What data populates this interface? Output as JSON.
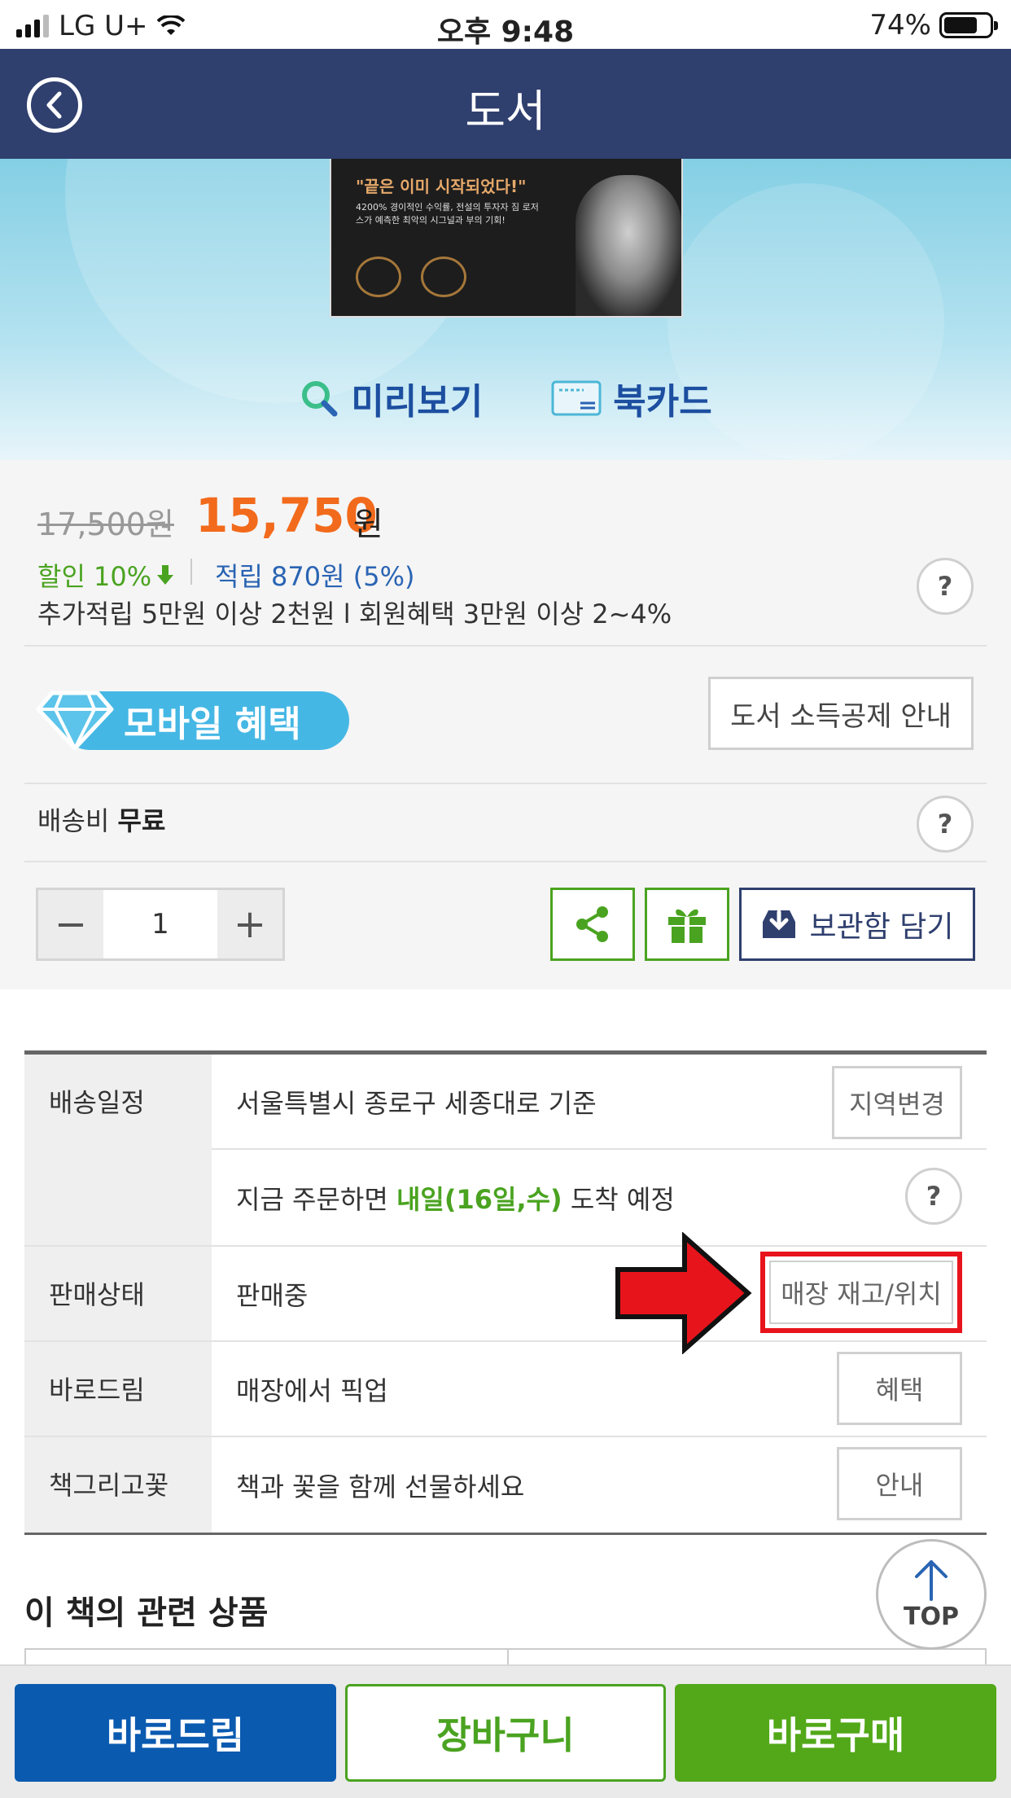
{
  "status_bar": {
    "carrier": "LG U+",
    "time": "오후 9:48",
    "battery": "74%",
    "battery_level": 0.74
  },
  "header": {
    "title": "도서",
    "back_icon": "chevron-left-circle-icon"
  },
  "hero": {
    "book_cover_quote": "\"끝은 이미 시작되었다!\"",
    "book_cover_sub": "4200% 경이적인 수익률, 전설의 투자자 짐 로저스가 예측한 최악의 시그널과 부의 기회!",
    "preview_label": "미리보기",
    "bookcard_label": "북카드"
  },
  "price": {
    "original": "17,500원",
    "sale": "15,750",
    "won": "원",
    "discount": "할인 10%",
    "points": "적립 870원 (5%)",
    "extra_points": "추가적립 5만원 이상 2천원 l 회원혜택 3만원 이상 2~4%",
    "help": "?"
  },
  "benefits": {
    "mobile_benefit": "모바일 혜택",
    "tax_deduction": "도서 소득공제 안내"
  },
  "shipping": {
    "label": "배송비",
    "value": "무료"
  },
  "quantity": {
    "minus": "−",
    "value": "1",
    "plus": "+"
  },
  "actions": {
    "save_to_storage": "보관함 담기"
  },
  "info_table": {
    "delivery_label": "배송일정",
    "delivery_location": "서울특별시 종로구 세종대로 기준",
    "region_change": "지역변경",
    "arrival_prefix": "지금 주문하면 ",
    "arrival_highlight": "내일(16일,수)",
    "arrival_suffix": " 도착 예정",
    "sale_status_label": "판매상태",
    "sale_status_value": "판매중",
    "store_stock": "매장 재고/위치",
    "barodream_label": "바로드림",
    "barodream_value": "매장에서 픽업",
    "barodream_btn": "혜택",
    "flower_label": "책그리고꽃",
    "flower_value": "책과 꽃을 함께 선물하세요",
    "flower_btn": "안내"
  },
  "related": {
    "title": "이 책의 관련 상품"
  },
  "top_button": "TOP",
  "bottom_bar": {
    "barodream": "바로드림",
    "cart": "장바구니",
    "buy_now": "바로구매"
  },
  "colors": {
    "header_bg": "#2f3f6e",
    "sale_price": "#f26a1b",
    "green": "#4aa320",
    "blue": "#0a5ab0",
    "highlight_red": "#e8141c"
  }
}
